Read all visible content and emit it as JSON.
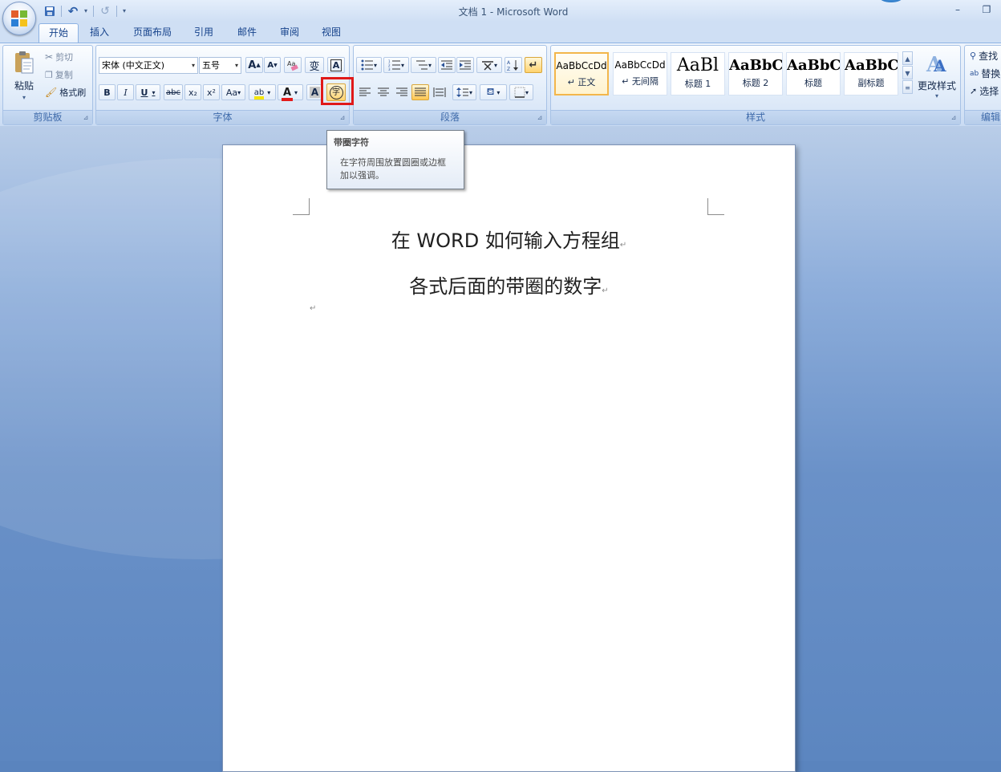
{
  "window": {
    "title": "文档 1 - Microsoft Word",
    "minimize_glyph": "–",
    "restore_glyph": "❐"
  },
  "qat": {
    "save_glyph": "💾",
    "undo_glyph": "↶",
    "redo_glyph": "↺",
    "dropdown_glyph": "▾",
    "customize_glyph": "⩡"
  },
  "tabs": [
    {
      "label": "开始",
      "active": true
    },
    {
      "label": "插入"
    },
    {
      "label": "页面布局"
    },
    {
      "label": "引用"
    },
    {
      "label": "邮件"
    },
    {
      "label": "审阅"
    },
    {
      "label": "视图"
    }
  ],
  "clipboard": {
    "group_label": "剪贴板",
    "paste_label": "粘贴",
    "paste_drop": "▾",
    "cut_label": "剪切",
    "copy_label": "复制",
    "format_painter_label": "格式刷",
    "launcher_glyph": "⊿"
  },
  "font": {
    "group_label": "字体",
    "font_name": "宋体 (中文正文)",
    "font_size": "五号",
    "grow_glyph": "A",
    "shrink_glyph": "A",
    "clear_format_glyph": "ᴬᵃ",
    "phonetic_glyph": "变",
    "char_border_glyph": "A",
    "bold": "B",
    "italic": "I",
    "underline": "U",
    "strike": "abc",
    "subscript": "x₂",
    "superscript": "x²",
    "change_case": "Aa",
    "highlight": "ab",
    "font_color": "A",
    "char_shading": "A",
    "enclosed_char": "字",
    "launcher_glyph": "⊿"
  },
  "paragraph": {
    "group_label": "段落",
    "launcher_glyph": "⊿"
  },
  "styles": {
    "group_label": "样式",
    "tiles": [
      {
        "sample": "AaBbCcDd",
        "name": "↵ 正文",
        "selected": true
      },
      {
        "sample": "AaBbCcDd",
        "name": "↵ 无间隔"
      },
      {
        "sample": "AaBl",
        "name": "标题 1"
      },
      {
        "sample": "AaBbC",
        "name": "标题 2"
      },
      {
        "sample": "AaBbC",
        "name": "标题"
      },
      {
        "sample": "AaBbC",
        "name": "副标题"
      }
    ],
    "change_styles_label": "更改样式",
    "change_styles_drop": "▾",
    "launcher_glyph": "⊿"
  },
  "editing": {
    "group_label": "编辑",
    "find_label": "查找",
    "replace_label": "替换",
    "select_label": "选择"
  },
  "tooltip": {
    "title": "带圈字符",
    "line1": "在字符周围放置圆圈或边框",
    "line2": "加以强调。"
  },
  "document": {
    "line1": "在 WORD 如何输入方程组",
    "line2": "各式后面的带圈的数字",
    "paragraph_mark": "↵"
  },
  "colors": {
    "highlight_red": "#e01919",
    "font_color_bar": "#e31b1b",
    "highlight_bar": "#f5e500",
    "accent_blue": "#15428b"
  }
}
